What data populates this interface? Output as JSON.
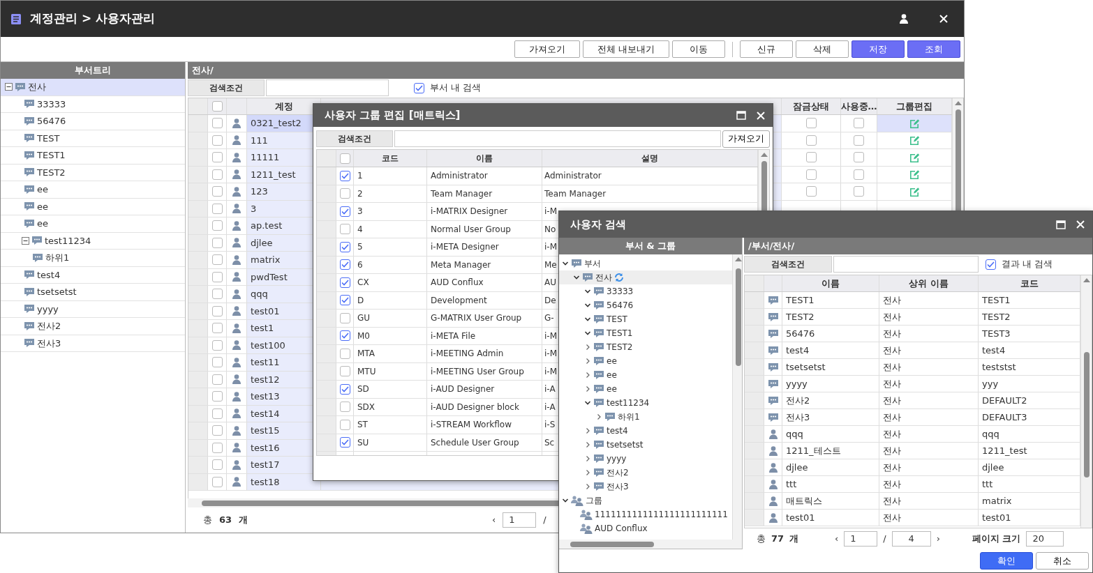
{
  "window": {
    "title": "계정관리 > 사용자관리"
  },
  "toolbar_groups": [
    [
      {
        "label": "가져오기",
        "primary": false
      },
      {
        "label": "전체 내보내기",
        "primary": false
      },
      {
        "label": "이동",
        "primary": false
      }
    ],
    [
      {
        "label": "신규",
        "primary": false
      },
      {
        "label": "삭제",
        "primary": false
      },
      {
        "label": "저장",
        "primary": true
      },
      {
        "label": "조회",
        "primary": true
      }
    ]
  ],
  "dept_tree": {
    "title": "부서트리",
    "items": [
      {
        "label": "전사",
        "expanded": true,
        "selected": true,
        "children": [
          {
            "label": "33333",
            "selected": false
          },
          {
            "label": "56476",
            "selected": false
          },
          {
            "label": "TEST",
            "selected": false
          },
          {
            "label": "TEST1",
            "selected": false
          },
          {
            "label": "TEST2",
            "selected": false
          },
          {
            "label": "ee",
            "selected": false
          },
          {
            "label": "ee",
            "selected": false
          },
          {
            "label": "ee",
            "selected": false
          },
          {
            "label": "test11234",
            "expanded": true,
            "selected": false,
            "children": [
              {
                "label": "하위1",
                "selected": false
              }
            ]
          },
          {
            "label": "test4",
            "selected": false
          },
          {
            "label": "tsetsetst",
            "selected": false
          },
          {
            "label": "yyyy",
            "selected": false
          },
          {
            "label": "전사2",
            "selected": false
          },
          {
            "label": "전사3",
            "selected": false
          }
        ]
      }
    ]
  },
  "users_panel": {
    "path": "전사/",
    "search_label": "검색조건",
    "scope": {
      "label": "부서 내 검색",
      "checked": true
    },
    "all_checked": false,
    "columns": {
      "account": "계정",
      "locked": "잠금상태",
      "in_use": "사용중…",
      "group_edit": "그룹편집"
    },
    "rows": [
      {
        "account": "0321_test2",
        "checked": false,
        "selected": true,
        "locked": false,
        "in_use": false
      },
      {
        "account": "111",
        "checked": false,
        "selected": false,
        "locked": false,
        "in_use": false
      },
      {
        "account": "11111",
        "checked": false,
        "selected": false,
        "locked": false,
        "in_use": false
      },
      {
        "account": "1211_test",
        "checked": false,
        "selected": false,
        "locked": false,
        "in_use": false
      },
      {
        "account": "123",
        "checked": false,
        "selected": false,
        "locked": false,
        "in_use": false
      },
      {
        "account": "3",
        "checked": false,
        "selected": false
      },
      {
        "account": "ap.test",
        "checked": false,
        "selected": false
      },
      {
        "account": "djlee",
        "checked": false,
        "selected": false
      },
      {
        "account": "matrix",
        "checked": false,
        "selected": false
      },
      {
        "account": "pwdTest",
        "checked": false,
        "selected": false
      },
      {
        "account": "qqq",
        "checked": false,
        "selected": false
      },
      {
        "account": "test01",
        "checked": false,
        "selected": false
      },
      {
        "account": "test1",
        "checked": false,
        "selected": false
      },
      {
        "account": "test100",
        "checked": false,
        "selected": false
      },
      {
        "account": "test11",
        "checked": false,
        "selected": false
      },
      {
        "account": "test12",
        "checked": false,
        "selected": false
      },
      {
        "account": "test13",
        "checked": false,
        "selected": false
      },
      {
        "account": "test14",
        "checked": false,
        "selected": false
      },
      {
        "account": "test15",
        "checked": false,
        "selected": false
      },
      {
        "account": "test16",
        "checked": false,
        "selected": false
      },
      {
        "account": "test17",
        "checked": false,
        "selected": false
      },
      {
        "account": "test18",
        "checked": false,
        "selected": false
      }
    ],
    "footer": {
      "total_label": "총",
      "total": "63",
      "unit": "개",
      "prev": "‹",
      "page": "1",
      "page_sep": "/"
    }
  },
  "group_dialog": {
    "title": "사용자 그룹 편집 [매트릭스]",
    "search_label": "검색조건",
    "fetch_button": "가져오기",
    "all_checked": false,
    "columns": [
      "코드",
      "이름",
      "설명"
    ],
    "rows": [
      {
        "code": "1",
        "name": "Administrator",
        "description": "Administrator",
        "checked": true
      },
      {
        "code": "2",
        "name": "Team Manager",
        "description": "Team Manager",
        "checked": false
      },
      {
        "code": "3",
        "name": "i-MATRIX Designer",
        "description": "i-M",
        "checked": true
      },
      {
        "code": "4",
        "name": "Normal User Group",
        "description": "No",
        "checked": false
      },
      {
        "code": "5",
        "name": "i-META Designer",
        "description": "i-M",
        "checked": true
      },
      {
        "code": "6",
        "name": "Meta Manager",
        "description": "Me",
        "checked": true
      },
      {
        "code": "CX",
        "name": "AUD Conflux",
        "description": "AU",
        "checked": true
      },
      {
        "code": "D",
        "name": "Development",
        "description": "De",
        "checked": true
      },
      {
        "code": "GU",
        "name": "G-MATRIX User Group",
        "description": "G-",
        "checked": false
      },
      {
        "code": "M0",
        "name": "i-META File",
        "description": "i-M",
        "checked": true
      },
      {
        "code": "MTA",
        "name": "i-MEETING Admin",
        "description": "i-M",
        "checked": false
      },
      {
        "code": "MTU",
        "name": "i-MEETING User Group",
        "description": "i-M",
        "checked": false
      },
      {
        "code": "SD",
        "name": "i-AUD Designer",
        "description": "i-A",
        "checked": true
      },
      {
        "code": "SDX",
        "name": "i-AUD Designer block",
        "description": "i-A",
        "checked": false
      },
      {
        "code": "ST",
        "name": "i-STREAM Workflow",
        "description": "i-S",
        "checked": false
      },
      {
        "code": "SU",
        "name": "Schedule User Group",
        "description": "Sc",
        "checked": true
      }
    ]
  },
  "user_search_dialog": {
    "title": "사용자 검색",
    "tree_title": "부서 & 그룹",
    "tree": [
      {
        "label": "부서",
        "kind": "dept",
        "expanded": true,
        "selected": false,
        "children": [
          {
            "label": "전사",
            "kind": "dept",
            "expanded": true,
            "selected": true,
            "refresh": true,
            "children": [
              {
                "label": "33333",
                "kind": "dept",
                "expanded": true,
                "selected": false
              },
              {
                "label": "56476",
                "kind": "dept",
                "expanded": true,
                "selected": false
              },
              {
                "label": "TEST",
                "kind": "dept",
                "expanded": true,
                "selected": false
              },
              {
                "label": "TEST1",
                "kind": "dept",
                "expanded": true,
                "selected": false
              },
              {
                "label": "TEST2",
                "kind": "dept",
                "expanded": false,
                "selected": false
              },
              {
                "label": "ee",
                "kind": "dept",
                "expanded": false,
                "selected": false
              },
              {
                "label": "ee",
                "kind": "dept",
                "expanded": false,
                "selected": false
              },
              {
                "label": "ee",
                "kind": "dept",
                "expanded": false,
                "selected": false
              },
              {
                "label": "test11234",
                "kind": "dept",
                "expanded": true,
                "selected": false,
                "children": [
                  {
                    "label": "하위1",
                    "kind": "dept",
                    "expanded": false,
                    "selected": false
                  }
                ]
              },
              {
                "label": "test4",
                "kind": "dept",
                "expanded": false,
                "selected": false
              },
              {
                "label": "tsetsetst",
                "kind": "dept",
                "expanded": false,
                "selected": false
              },
              {
                "label": "yyyy",
                "kind": "dept",
                "expanded": false,
                "selected": false
              },
              {
                "label": "전사2",
                "kind": "dept",
                "expanded": false,
                "selected": false
              },
              {
                "label": "전사3",
                "kind": "dept",
                "expanded": false,
                "selected": false
              }
            ]
          }
        ]
      },
      {
        "label": "그룹",
        "kind": "group",
        "expanded": true,
        "selected": false,
        "children": [
          {
            "label": "1111111111111111111111111",
            "kind": "group",
            "selected": false
          },
          {
            "label": "AUD Conflux",
            "kind": "group",
            "selected": false
          }
        ]
      }
    ],
    "path": "/부서/전사/",
    "search_label": "검색조건",
    "scope": {
      "label": "결과 내 검색",
      "checked": true
    },
    "columns": [
      "이름",
      "상위 이름",
      "코드"
    ],
    "rows": [
      {
        "kind": "dept",
        "name": "TEST1",
        "parent": "전사",
        "code": "TEST1"
      },
      {
        "kind": "dept",
        "name": "TEST2",
        "parent": "전사",
        "code": "TEST2"
      },
      {
        "kind": "dept",
        "name": "56476",
        "parent": "전사",
        "code": "TEST3"
      },
      {
        "kind": "dept",
        "name": "test4",
        "parent": "전사",
        "code": "test4"
      },
      {
        "kind": "dept",
        "name": "tsetsetst",
        "parent": "전사",
        "code": "teststst"
      },
      {
        "kind": "dept",
        "name": "yyyy",
        "parent": "전사",
        "code": "yyy"
      },
      {
        "kind": "dept",
        "name": "전사2",
        "parent": "전사",
        "code": "DEFAULT2"
      },
      {
        "kind": "dept",
        "name": "전사3",
        "parent": "전사",
        "code": "DEFAULT3"
      },
      {
        "kind": "user",
        "name": "qqq",
        "parent": "전사",
        "code": "qqq"
      },
      {
        "kind": "user",
        "name": "1211_테스트",
        "parent": "전사",
        "code": "1211_test"
      },
      {
        "kind": "user",
        "name": "djlee",
        "parent": "전사",
        "code": "djlee"
      },
      {
        "kind": "user",
        "name": "ttt",
        "parent": "전사",
        "code": "ttt"
      },
      {
        "kind": "user",
        "name": "매트릭스",
        "parent": "전사",
        "code": "matrix"
      },
      {
        "kind": "user",
        "name": "test01",
        "parent": "전사",
        "code": "test01"
      }
    ],
    "footer": {
      "total_label": "총",
      "total": "77",
      "unit": "개",
      "prev": "‹",
      "page": "1",
      "page_sep": "/",
      "pages": "4",
      "next": "›",
      "page_size_label": "페이지 크기",
      "page_size": "20"
    },
    "buttons": [
      {
        "label": "확인",
        "primary": true
      },
      {
        "label": "취소",
        "primary": false
      }
    ]
  }
}
